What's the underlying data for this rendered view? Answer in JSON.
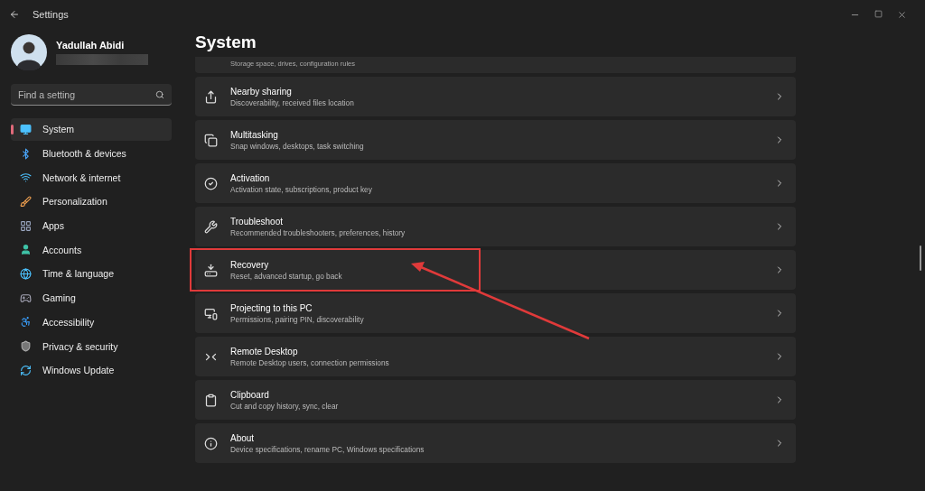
{
  "window": {
    "title": "Settings"
  },
  "account": {
    "name": "Yadullah Abidi"
  },
  "search": {
    "placeholder": "Find a setting"
  },
  "sidebar": {
    "items": [
      {
        "label": "System",
        "selected": true
      },
      {
        "label": "Bluetooth & devices",
        "selected": false
      },
      {
        "label": "Network & internet",
        "selected": false
      },
      {
        "label": "Personalization",
        "selected": false
      },
      {
        "label": "Apps",
        "selected": false
      },
      {
        "label": "Accounts",
        "selected": false
      },
      {
        "label": "Time & language",
        "selected": false
      },
      {
        "label": "Gaming",
        "selected": false
      },
      {
        "label": "Accessibility",
        "selected": false
      },
      {
        "label": "Privacy & security",
        "selected": false
      },
      {
        "label": "Windows Update",
        "selected": false
      }
    ]
  },
  "page": {
    "title": "System",
    "partial_item": {
      "subtitle": "Storage space, drives, configuration rules"
    },
    "items": [
      {
        "title": "Nearby sharing",
        "subtitle": "Discoverability, received files location",
        "highlighted": false
      },
      {
        "title": "Multitasking",
        "subtitle": "Snap windows, desktops, task switching",
        "highlighted": false
      },
      {
        "title": "Activation",
        "subtitle": "Activation state, subscriptions, product key",
        "highlighted": false
      },
      {
        "title": "Troubleshoot",
        "subtitle": "Recommended troubleshooters, preferences, history",
        "highlighted": false
      },
      {
        "title": "Recovery",
        "subtitle": "Reset, advanced startup, go back",
        "highlighted": true
      },
      {
        "title": "Projecting to this PC",
        "subtitle": "Permissions, pairing PIN, discoverability",
        "highlighted": false
      },
      {
        "title": "Remote Desktop",
        "subtitle": "Remote Desktop users, connection permissions",
        "highlighted": false
      },
      {
        "title": "Clipboard",
        "subtitle": "Cut and copy history, sync, clear",
        "highlighted": false
      },
      {
        "title": "About",
        "subtitle": "Device specifications, rename PC, Windows specifications",
        "highlighted": false
      }
    ]
  }
}
